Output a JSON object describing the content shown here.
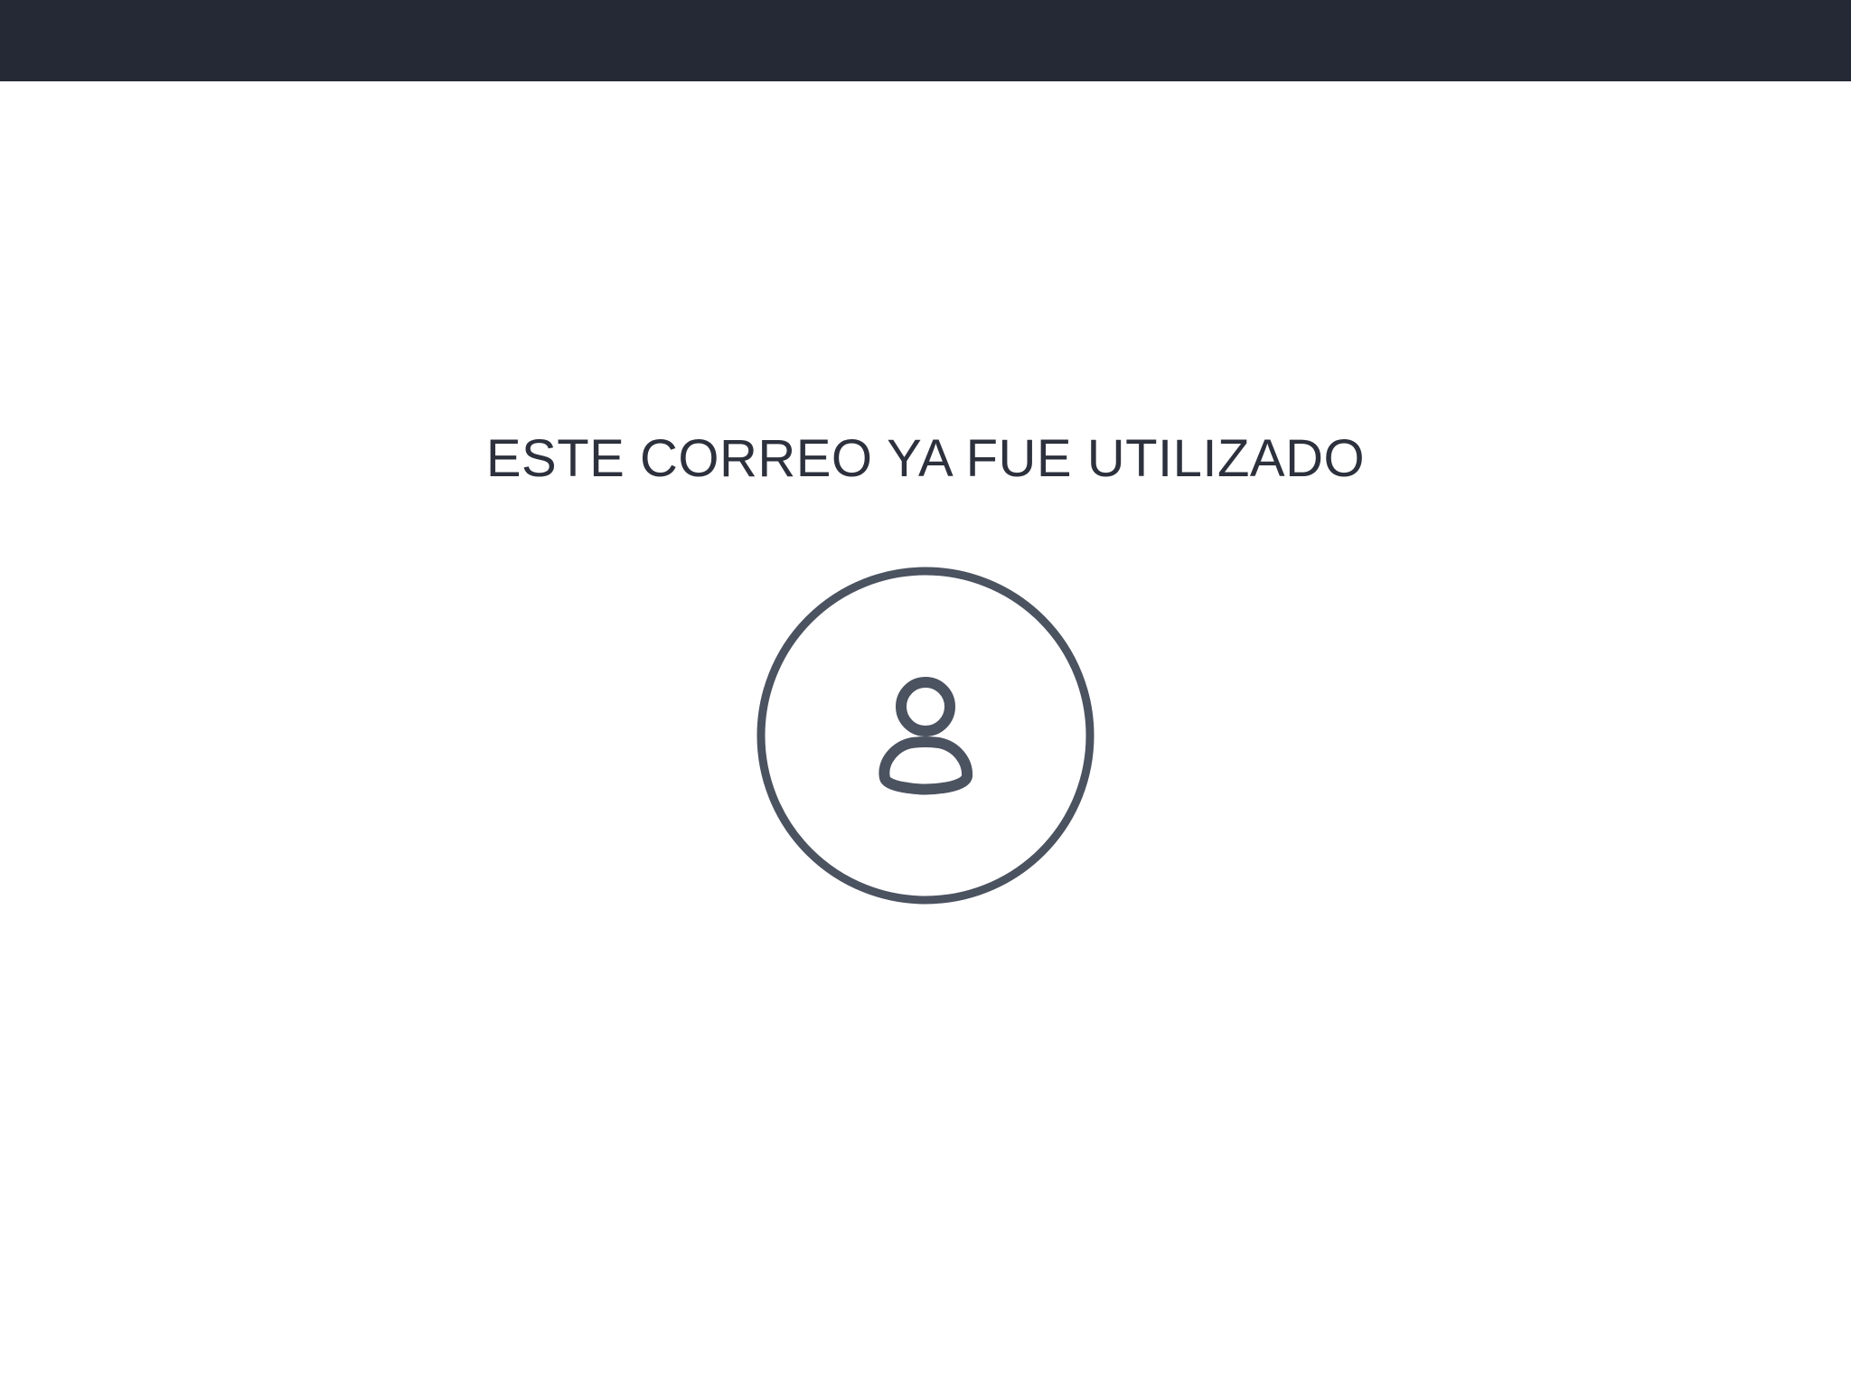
{
  "header": {
    "background_color": "#252935"
  },
  "main": {
    "message": "ESTE CORREO YA FUE UTILIZADO",
    "message_color": "#2d313d",
    "avatar": {
      "icon": "user-icon",
      "stroke_color": "#4b5260"
    }
  }
}
